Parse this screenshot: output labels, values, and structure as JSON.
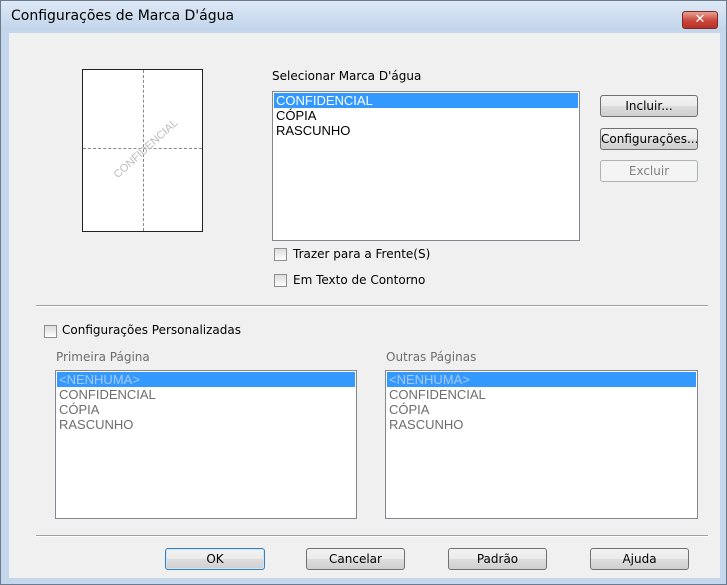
{
  "window": {
    "title": "Configurações de Marca D'água",
    "close_label": "✕"
  },
  "preview": {
    "watermark_text": "CONFIDENCIAL"
  },
  "select": {
    "label": "Selecionar Marca D'água",
    "items": [
      "CONFIDENCIAL",
      "CÓPIA",
      "RASCUNHO"
    ],
    "selected_index": 0
  },
  "side_buttons": {
    "include": "Incluir...",
    "settings": "Configurações...",
    "delete": "Excluir"
  },
  "options": {
    "bring_to_front": "Trazer para a Frente(S)",
    "outline_text": "Em Texto de Contorno"
  },
  "custom": {
    "checkbox_label": "Configurações Personalizadas",
    "first_page": {
      "label": "Primeira Página",
      "items": [
        "<NENHUMA>",
        "CONFIDENCIAL",
        "CÓPIA",
        "RASCUNHO"
      ]
    },
    "other_pages": {
      "label": "Outras Páginas",
      "items": [
        "<NENHUMA>",
        "CONFIDENCIAL",
        "CÓPIA",
        "RASCUNHO"
      ]
    }
  },
  "footer": {
    "ok": "OK",
    "cancel": "Cancelar",
    "default": "Padrão",
    "help": "Ajuda"
  }
}
